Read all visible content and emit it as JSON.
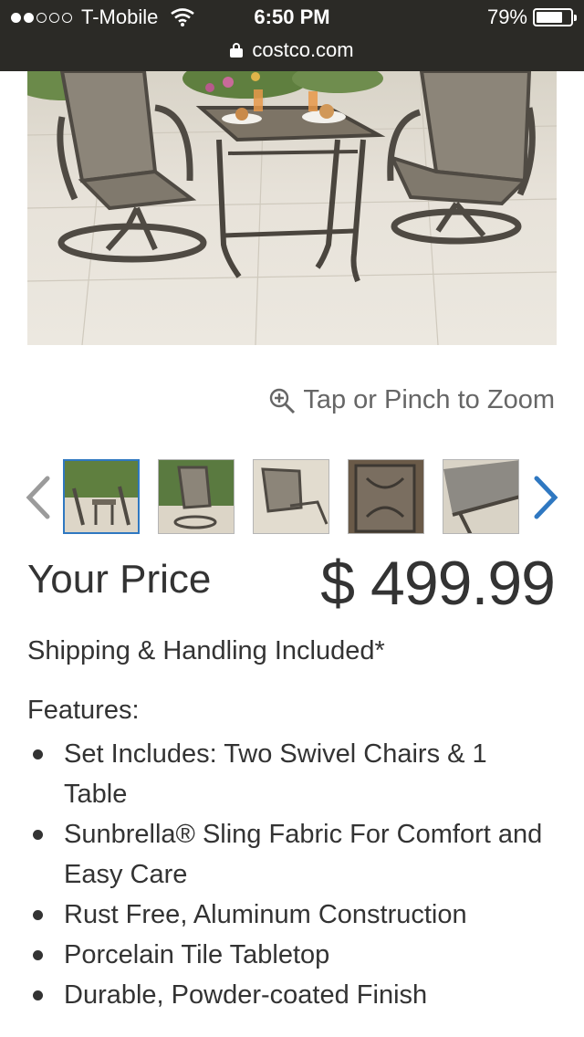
{
  "status_bar": {
    "carrier": "T-Mobile",
    "time": "6:50 PM",
    "battery": "79%",
    "battery_level": 0.79,
    "signal_bars_filled": 2,
    "signal_bars_total": 5
  },
  "url_bar": {
    "domain": "costco.com"
  },
  "product": {
    "zoom_hint": "Tap or Pinch to Zoom",
    "price_label": "Your Price",
    "price": "$ 499.99",
    "shipping": "Shipping & Handling Included*",
    "features_title": "Features:",
    "features": [
      "Set Includes: Two Swivel Chairs & 1 Table",
      "Sunbrella® Sling Fabric For Comfort and Easy Care",
      "Rust Free, Aluminum Construction",
      "Porcelain Tile Tabletop",
      "Durable, Powder-coated Finish"
    ]
  },
  "colors": {
    "status_bg": "#2b2a26",
    "accent_blue": "#2f78c1",
    "text": "#333333"
  },
  "icons": {
    "zoom": "magnifier-plus-icon",
    "prev": "chevron-left-icon",
    "next": "chevron-right-icon",
    "lock": "lock-icon",
    "wifi": "wifi-icon"
  }
}
